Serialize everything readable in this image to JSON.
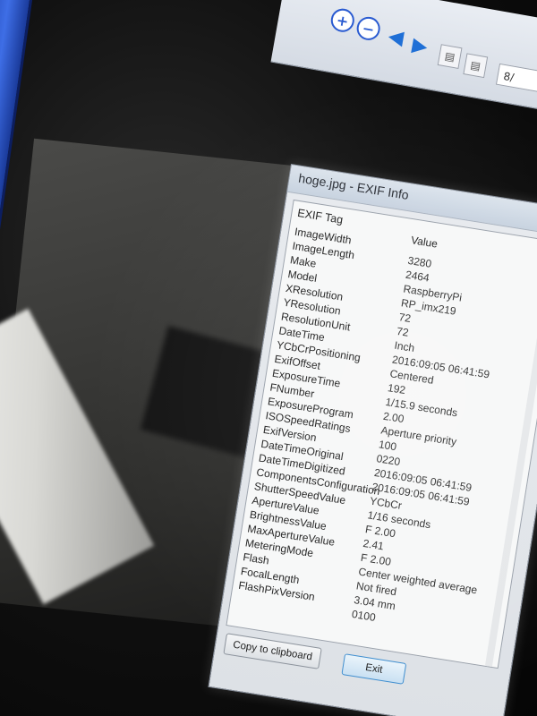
{
  "toolbar": {
    "page_indicator": "8/",
    "icons": [
      "zoom-in-icon",
      "zoom-out-icon",
      "arrow-left-icon",
      "arrow-right-icon",
      "page-prev-icon",
      "page-next-icon"
    ]
  },
  "dialog": {
    "title": "hoge.jpg - EXIF Info",
    "list_header": "EXIF Tag",
    "value_header": "Value",
    "tags": [
      "ImageWidth",
      "ImageLength",
      "Make",
      "Model",
      "XResolution",
      "YResolution",
      "ResolutionUnit",
      "DateTime",
      "YCbCrPositioning",
      "ExifOffset",
      "ExposureTime",
      "FNumber",
      "ExposureProgram",
      "ISOSpeedRatings",
      "ExifVersion",
      "DateTimeOriginal",
      "DateTimeDigitized",
      "ComponentsConfiguration",
      "ShutterSpeedValue",
      "ApertureValue",
      "BrightnessValue",
      "MaxApertureValue",
      "MeteringMode",
      "Flash",
      "FocalLength",
      "FlashPixVersion"
    ],
    "values": [
      "3280",
      "2464",
      "RaspberryPi",
      "RP_imx219",
      "72",
      "72",
      "Inch",
      "2016:09:05 06:41:59",
      "Centered",
      "192",
      "1/15.9 seconds",
      "2.00",
      "Aperture priority",
      "100",
      "0220",
      "2016:09:05 06:41:59",
      "2016:09:05 06:41:59",
      "YCbCr",
      "1/16 seconds",
      "F 2.00",
      "2.41",
      "F 2.00",
      "Center weighted average",
      "Not fired",
      "3.04 mm",
      "0100"
    ],
    "copy_button": "Copy to clipboard",
    "exit_button": "Exit"
  }
}
